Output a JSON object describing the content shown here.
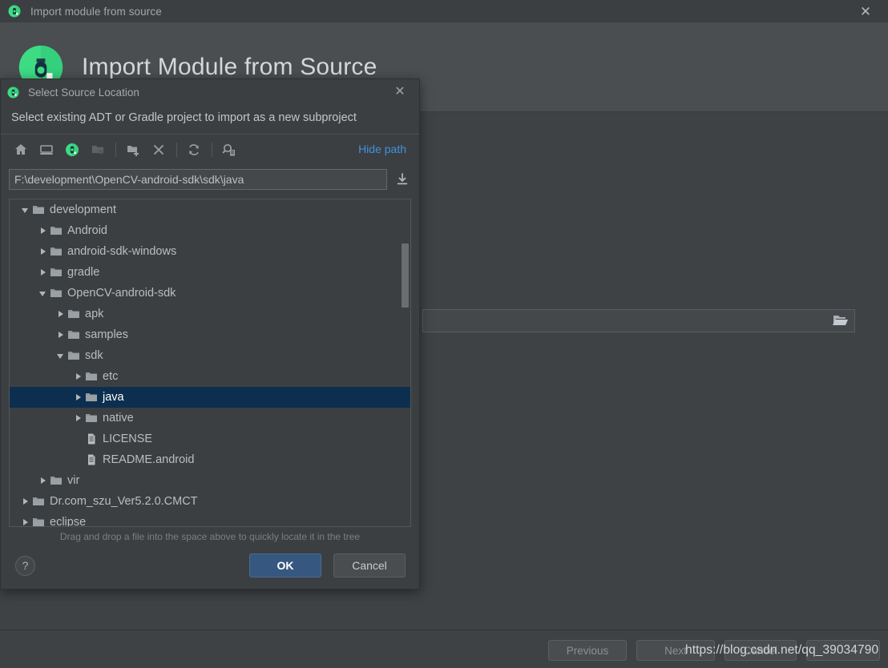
{
  "window": {
    "title": "Import module from source",
    "icon": "android-studio-icon",
    "close_label": "✕"
  },
  "wizard": {
    "heading": "Import Module from Source",
    "logo": "android-studio-logo",
    "source_field_value": "",
    "browse_icon": "folder-open-icon",
    "footer": {
      "previous_label": "Previous",
      "next_label": "Next",
      "cancel_label": "Cancel",
      "finish_label": ""
    }
  },
  "watermark": {
    "text": "https://blog.csdn.net/qq_39034790"
  },
  "dialog": {
    "title": "Select Source Location",
    "title_icon": "android-studio-icon",
    "close_label": "✕",
    "description": "Select existing ADT or Gradle project to import as a new subproject",
    "toolbar": {
      "buttons": [
        {
          "name": "home-icon",
          "title": "Home",
          "enabled": true
        },
        {
          "name": "desktop-icon",
          "title": "Desktop",
          "enabled": true
        },
        {
          "name": "android-project-icon",
          "title": "Project",
          "enabled": true
        },
        {
          "name": "folder-icon",
          "title": "Module",
          "enabled": false
        },
        {
          "name": "new-folder-icon",
          "title": "New Folder",
          "enabled": true
        },
        {
          "name": "delete-icon",
          "title": "Delete",
          "enabled": true
        },
        {
          "name": "refresh-icon",
          "title": "Refresh",
          "enabled": true
        },
        {
          "name": "show-hidden-icon",
          "title": "Show Hidden",
          "enabled": true
        }
      ],
      "hide_path_label": "Hide path"
    },
    "path": {
      "value": "F:\\development\\OpenCV-android-sdk\\sdk\\java",
      "placeholder": "",
      "download_icon": "download-icon"
    },
    "tree": {
      "items": [
        {
          "label": "development",
          "indent": 0,
          "type": "folder",
          "state": "expanded",
          "selected": false
        },
        {
          "label": "Android",
          "indent": 1,
          "type": "folder",
          "state": "collapsed",
          "selected": false
        },
        {
          "label": "android-sdk-windows",
          "indent": 1,
          "type": "folder",
          "state": "collapsed",
          "selected": false
        },
        {
          "label": "gradle",
          "indent": 1,
          "type": "folder",
          "state": "collapsed",
          "selected": false
        },
        {
          "label": "OpenCV-android-sdk",
          "indent": 1,
          "type": "folder",
          "state": "expanded",
          "selected": false
        },
        {
          "label": "apk",
          "indent": 2,
          "type": "folder",
          "state": "collapsed",
          "selected": false
        },
        {
          "label": "samples",
          "indent": 2,
          "type": "folder",
          "state": "collapsed",
          "selected": false
        },
        {
          "label": "sdk",
          "indent": 2,
          "type": "folder",
          "state": "expanded",
          "selected": false
        },
        {
          "label": "etc",
          "indent": 3,
          "type": "folder",
          "state": "collapsed",
          "selected": false
        },
        {
          "label": "java",
          "indent": 3,
          "type": "folder",
          "state": "collapsed",
          "selected": true
        },
        {
          "label": "native",
          "indent": 3,
          "type": "folder",
          "state": "collapsed",
          "selected": false
        },
        {
          "label": "LICENSE",
          "indent": 3,
          "type": "file",
          "state": "none",
          "selected": false
        },
        {
          "label": "README.android",
          "indent": 3,
          "type": "file",
          "state": "none",
          "selected": false
        },
        {
          "label": "vir",
          "indent": 1,
          "type": "folder",
          "state": "collapsed",
          "selected": false
        },
        {
          "label": "Dr.com_szu_Ver5.2.0.CMCT",
          "indent": 0,
          "type": "folder",
          "state": "collapsed",
          "selected": false
        },
        {
          "label": "eclipse",
          "indent": 0,
          "type": "folder",
          "state": "collapsed",
          "selected": false
        }
      ],
      "scroll_thumb_top_pct": 13,
      "scroll_thumb_height_pct": 20
    },
    "hint": "Drag and drop a file into the space above to quickly locate it in the tree",
    "buttons": {
      "help_label": "?",
      "ok_label": "OK",
      "cancel_label": "Cancel"
    }
  },
  "colors": {
    "accent_blue": "#3f92dd",
    "selection_blue": "#0d2f4f",
    "ok_button_blue": "#365880",
    "android_green": "#3ddc84",
    "window_bg": "#3c3f41",
    "wizard_bg": "#3f4244"
  }
}
